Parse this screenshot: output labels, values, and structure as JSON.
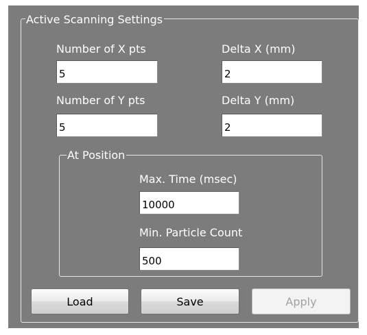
{
  "active_scanning": {
    "group_title": "Active Scanning Settings",
    "num_x": {
      "label": "Number of X pts",
      "value": "5"
    },
    "delta_x": {
      "label": "Delta X (mm)",
      "value": "2"
    },
    "num_y": {
      "label": "Number of Y pts",
      "value": "5"
    },
    "delta_y": {
      "label": "Delta Y (mm)",
      "value": "2"
    }
  },
  "at_position": {
    "group_title": "At Position",
    "max_time": {
      "label": "Max. Time (msec)",
      "value": "10000"
    },
    "min_particle": {
      "label": "Min. Particle Count",
      "value": "500"
    }
  },
  "buttons": {
    "load": "Load",
    "save": "Save",
    "apply": "Apply",
    "apply_enabled": false
  }
}
